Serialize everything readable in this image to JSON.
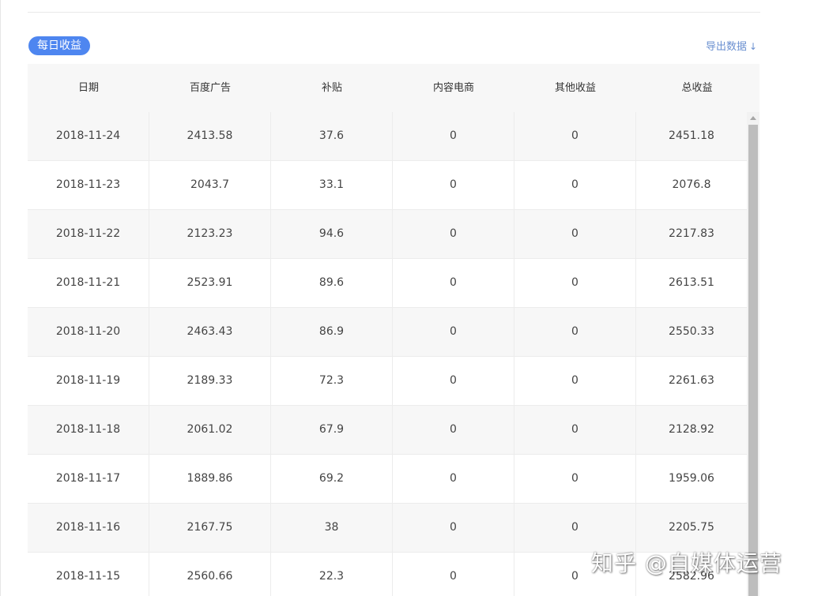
{
  "section": {
    "badge_label": "每日收益",
    "export_label": "导出数据",
    "export_icon": "↓"
  },
  "table": {
    "columns": [
      "日期",
      "百度广告",
      "补贴",
      "内容电商",
      "其他收益",
      "总收益"
    ],
    "rows": [
      [
        "2018-11-24",
        "2413.58",
        "37.6",
        "0",
        "0",
        "2451.18"
      ],
      [
        "2018-11-23",
        "2043.7",
        "33.1",
        "0",
        "0",
        "2076.8"
      ],
      [
        "2018-11-22",
        "2123.23",
        "94.6",
        "0",
        "0",
        "2217.83"
      ],
      [
        "2018-11-21",
        "2523.91",
        "89.6",
        "0",
        "0",
        "2613.51"
      ],
      [
        "2018-11-20",
        "2463.43",
        "86.9",
        "0",
        "0",
        "2550.33"
      ],
      [
        "2018-11-19",
        "2189.33",
        "72.3",
        "0",
        "0",
        "2261.63"
      ],
      [
        "2018-11-18",
        "2061.02",
        "67.9",
        "0",
        "0",
        "2128.92"
      ],
      [
        "2018-11-17",
        "1889.86",
        "69.2",
        "0",
        "0",
        "1959.06"
      ],
      [
        "2018-11-16",
        "2167.75",
        "38",
        "0",
        "0",
        "2205.75"
      ],
      [
        "2018-11-15",
        "2560.66",
        "22.3",
        "0",
        "0",
        "2582.96"
      ]
    ]
  },
  "watermark": "知乎 @自媒体运营",
  "colors": {
    "accent": "#4e86f0",
    "link": "#6a8fd0",
    "header_bg": "#f7f7f7"
  }
}
